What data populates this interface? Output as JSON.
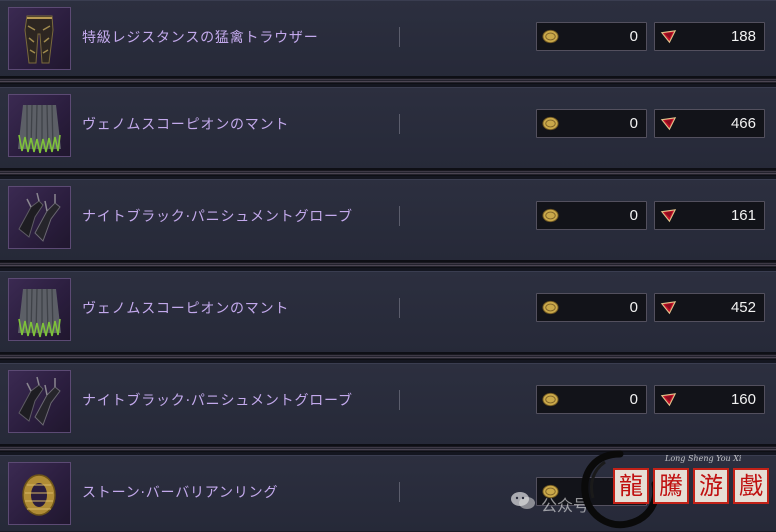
{
  "items": [
    {
      "name": "特級レジスタンスの猛禽トラウザー",
      "icon": "trousers-icon",
      "gold": "0",
      "gem": "188"
    },
    {
      "name": "ヴェノムスコーピオンのマント",
      "icon": "cloak-icon",
      "gold": "0",
      "gem": "466"
    },
    {
      "name": "ナイトブラック·パニシュメントグローブ",
      "icon": "gloves-icon",
      "gold": "0",
      "gem": "161"
    },
    {
      "name": "ヴェノムスコーピオンのマント",
      "icon": "cloak-icon",
      "gold": "0",
      "gem": "452"
    },
    {
      "name": "ナイトブラック·パニシュメントグローブ",
      "icon": "gloves-icon",
      "gold": "0",
      "gem": "160"
    },
    {
      "name": "ストーン·バーバリアンリング",
      "icon": "ring-icon",
      "gold": "0",
      "gem": ""
    }
  ],
  "currency": {
    "gold_icon": "gold-coin-icon",
    "gem_icon": "red-gem-icon",
    "gold_color": "#c9a84a",
    "gem_color": "#c5122a"
  },
  "colors": {
    "item_name": "#c3a9ec",
    "row_bg": "#2a2d3c"
  },
  "watermark": {
    "text": "公众号",
    "tagline": "Long Sheng You Xi"
  }
}
